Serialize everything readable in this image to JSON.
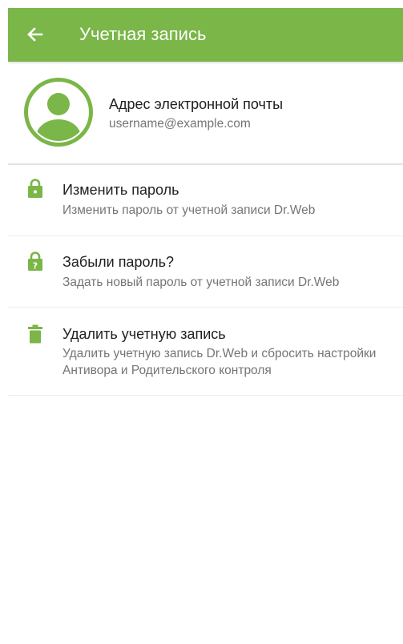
{
  "colors": {
    "accent": "#7ab648",
    "title_text": "#212121",
    "secondary_text": "#757575",
    "divider": "#ececec"
  },
  "appbar": {
    "back_icon": "arrow-left-icon",
    "title": "Учетная запись"
  },
  "account": {
    "avatar_icon": "user-avatar-icon",
    "label": "Адрес электронной почты",
    "email": "username@example.com"
  },
  "menu": {
    "items": [
      {
        "icon": "lock-icon",
        "title": "Изменить пароль",
        "subtitle": "Изменить пароль от учетной записи Dr.Web"
      },
      {
        "icon": "lock-question-icon",
        "title": "Забыли пароль?",
        "subtitle": "Задать новый пароль от учетной записи Dr.Web"
      },
      {
        "icon": "trash-icon",
        "title": "Удалить учетную запись",
        "subtitle": "Удалить учетную запись Dr.Web и сбросить настройки Антивора и Родительского контроля"
      }
    ]
  }
}
